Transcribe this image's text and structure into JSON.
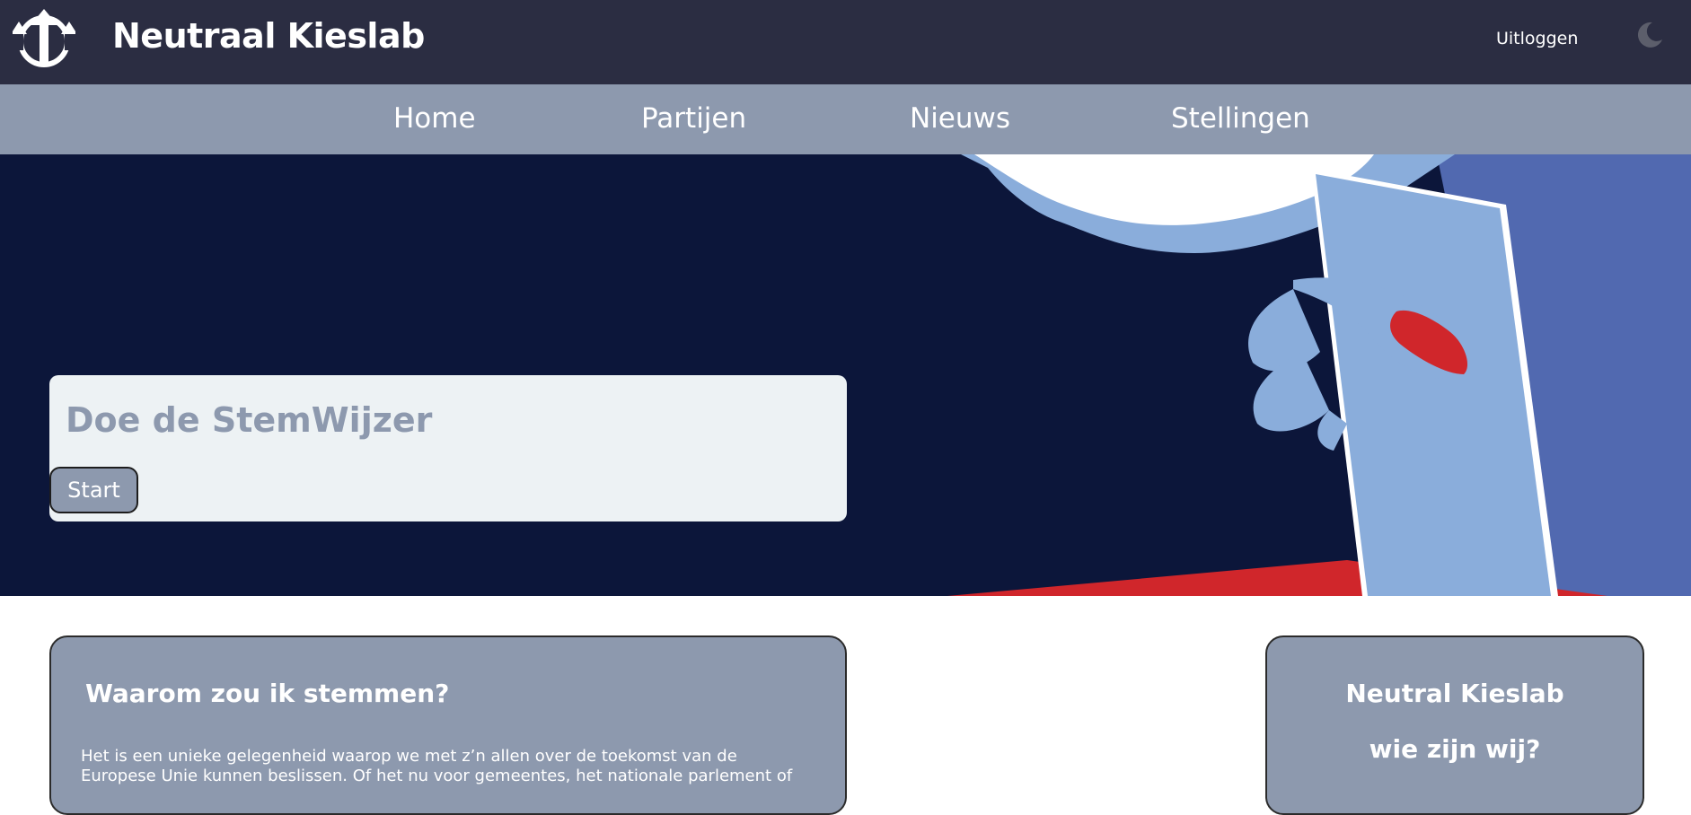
{
  "header": {
    "brand": "Neutraal Kieslab",
    "logo_icon": "arrows-up-anchor-icon",
    "logout_label": "Uitloggen",
    "theme_icon": "moon-icon"
  },
  "nav": {
    "items": [
      {
        "label": "Home"
      },
      {
        "label": "Partijen"
      },
      {
        "label": "Nieuws"
      },
      {
        "label": "Stellingen"
      }
    ]
  },
  "hero": {
    "card_title": "Doe de StemWijzer",
    "start_label": "Start",
    "illustration": "hand-casting-ballot"
  },
  "cards": {
    "why": {
      "title": "Waarom zou ik stemmen?",
      "text": "Het is een unieke gelegenheid waarop we met z’n allen over de toekomst van de Europese Unie kunnen beslissen. Of het nu voor gemeentes, het nationale parlement of"
    },
    "who": {
      "title": "Neutral Kieslab",
      "subtitle": "wie zijn wij?"
    }
  },
  "colors": {
    "header_bg": "#2b2d42",
    "nav_bg": "#8d99ae",
    "hero_bg": "#0c163a",
    "card_bg": "#8d99ae",
    "accent_red": "#d0262b",
    "ballot_blue": "#8aaddb"
  }
}
